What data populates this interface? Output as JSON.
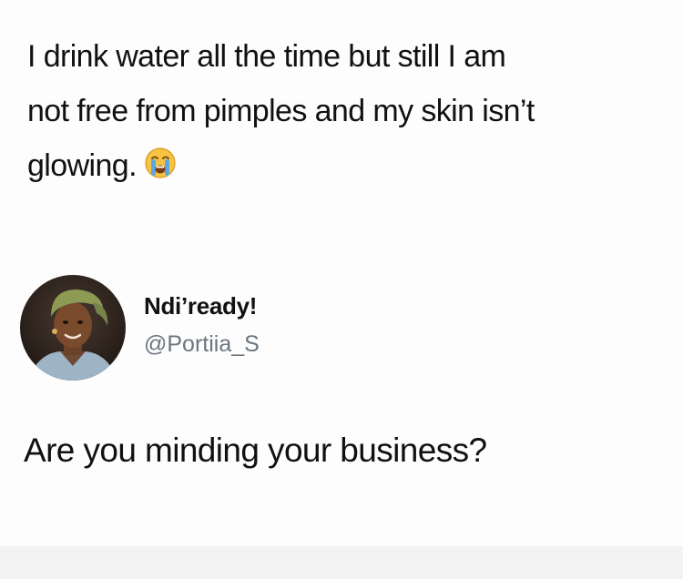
{
  "tweet": {
    "text_lines": [
      "I drink water all the time but still I am",
      "not free from pimples and my skin isn’t",
      "glowing."
    ],
    "emoji": "loudly-crying-face-icon"
  },
  "author": {
    "display_name": "Ndi’ready!",
    "handle": "@Portiia_S",
    "avatar": "avatar"
  },
  "reply": {
    "text": "Are you minding your business?"
  },
  "colors": {
    "text": "#111111",
    "handle": "#6b7680",
    "background": "#fdfdfd",
    "emoji_face": "#f6c343",
    "emoji_tears": "#5aa7e8"
  }
}
